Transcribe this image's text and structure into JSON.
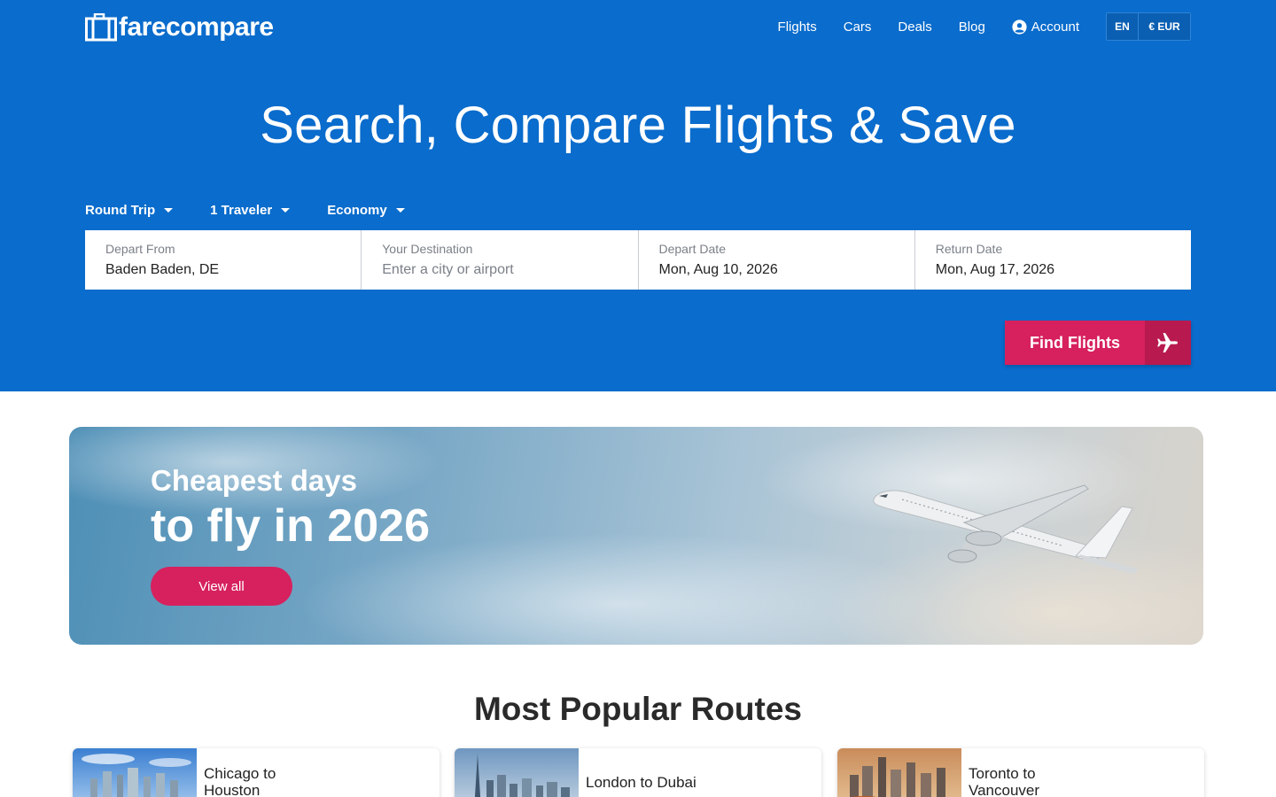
{
  "brand": {
    "name": "farecompare"
  },
  "nav": {
    "links": [
      "Flights",
      "Cars",
      "Deals",
      "Blog"
    ],
    "account_label": "Account",
    "lang": "EN",
    "currency": "€ EUR"
  },
  "hero": {
    "title": "Search, Compare Flights & Save",
    "options": {
      "trip_type": "Round Trip",
      "travelers": "1 Traveler",
      "cabin": "Economy"
    },
    "fields": {
      "depart_from": {
        "label": "Depart From",
        "value": "Baden Baden, DE"
      },
      "destination": {
        "label": "Your Destination",
        "placeholder": "Enter a city or airport"
      },
      "depart_date": {
        "label": "Depart Date",
        "value": "Mon, Aug 10, 2026"
      },
      "return_date": {
        "label": "Return Date",
        "value": "Mon, Aug 17, 2026"
      }
    },
    "find_label": "Find Flights"
  },
  "banner": {
    "subtitle": "Cheapest days",
    "title": "to fly in 2026",
    "button": "View all"
  },
  "routes": {
    "title": "Most Popular Routes",
    "cards": [
      {
        "line1": "Chicago to",
        "line2": "Houston"
      },
      {
        "line1": "London to Dubai",
        "line2": ""
      },
      {
        "line1": "Toronto to",
        "line2": "Vancouver"
      }
    ]
  },
  "colors": {
    "brand_blue": "#0a6ccc",
    "accent_pink": "#d6215e"
  },
  "icons": [
    "suitcase-logo-icon",
    "account-icon",
    "caret-down-icon",
    "airplane-icon"
  ]
}
